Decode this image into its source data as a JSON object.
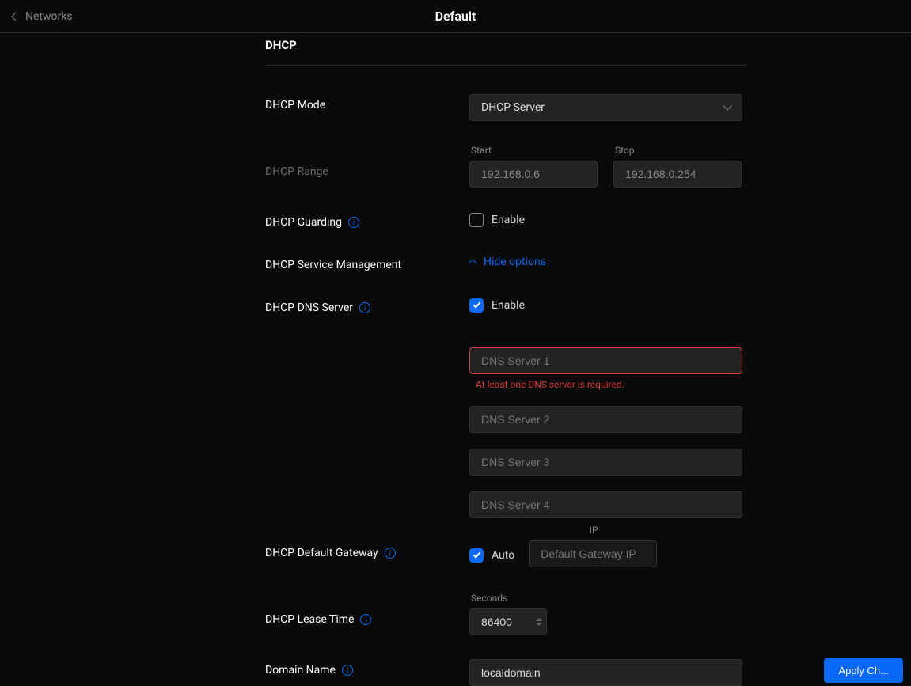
{
  "header": {
    "back_label": "Networks",
    "title": "Default"
  },
  "section": {
    "title": "DHCP"
  },
  "fields": {
    "mode": {
      "label": "DHCP Mode",
      "selected": "DHCP Server"
    },
    "range": {
      "label": "DHCP Range",
      "start_label": "Start",
      "start_value": "192.168.0.6",
      "stop_label": "Stop",
      "stop_value": "192.168.0.254"
    },
    "guarding": {
      "label": "DHCP Guarding",
      "enable_label": "Enable"
    },
    "service_mgmt": {
      "label": "DHCP Service Management",
      "toggle_text": "Hide options"
    },
    "dns": {
      "label": "DHCP DNS Server",
      "enable_label": "Enable",
      "server1_placeholder": "DNS Server 1",
      "error": "At least one DNS server is required.",
      "server2_placeholder": "DNS Server 2",
      "server3_placeholder": "DNS Server 3",
      "server4_placeholder": "DNS Server 4"
    },
    "gateway": {
      "label": "DHCP Default Gateway",
      "auto_label": "Auto",
      "ip_label": "IP",
      "ip_placeholder": "Default Gateway IP"
    },
    "lease": {
      "label": "DHCP Lease Time",
      "seconds_label": "Seconds",
      "value": "86400"
    },
    "domain": {
      "label": "Domain Name",
      "value": "localdomain"
    }
  },
  "footer": {
    "apply": "Apply Ch..."
  }
}
